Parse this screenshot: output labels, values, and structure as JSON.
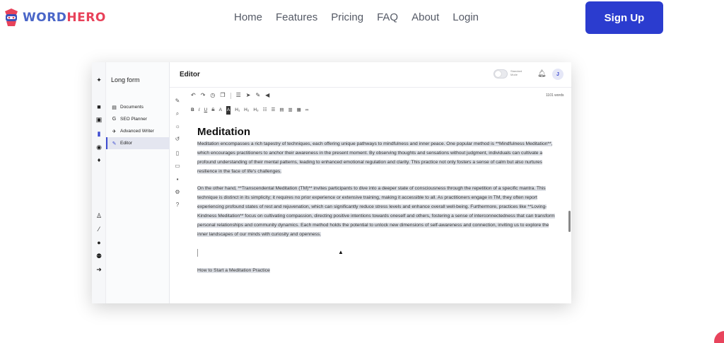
{
  "brand": {
    "name_part1": "WORD",
    "name_part2": "HERO"
  },
  "nav": [
    "Home",
    "Features",
    "Pricing",
    "FAQ",
    "About",
    "Login"
  ],
  "signup_label": "Sign Up",
  "app": {
    "sidebar_title": "Long form",
    "sidebar_items": [
      {
        "icon": "document-icon",
        "glyph": "▤",
        "label": "Documents"
      },
      {
        "icon": "google-icon",
        "glyph": "G",
        "label": "SEO Planner"
      },
      {
        "icon": "rocket-icon",
        "glyph": "✈",
        "label": "Advanced Writer"
      },
      {
        "icon": "pen-icon",
        "glyph": "✎",
        "label": "Editor"
      }
    ],
    "header_title": "Editor",
    "toggle_label": "Standard Mode",
    "avatar_initial": "J",
    "word_count": "1101 words",
    "format_buttons": [
      "B",
      "I",
      "U",
      "S",
      "A",
      "A",
      "H₁",
      "H₂",
      "H₃"
    ],
    "doc": {
      "title": "Meditation",
      "paragraphs": [
        "Meditation encompasses a rich tapestry of techniques, each offering unique pathways to mindfulness and inner peace. One popular method is **Mindfulness Meditation**, which encourages practitioners to anchor their awareness in the present moment. By observing thoughts and sensations without judgment, individuals can cultivate a profound understanding of their mental patterns, leading to enhanced emotional regulation and clarity. This practice not only fosters a sense of calm but also nurtures resilience in the face of life's challenges.",
        "On the other hand, **Transcendental Meditation (TM)** invites participants to dive into a deeper state of consciousness through the repetition of a specific mantra. This technique is distinct in its simplicity; it requires no prior experience or extensive training, making it accessible to all. As practitioners engage in TM, they often report experiencing profound states of rest and rejuvenation, which can significantly reduce stress levels and enhance overall well-being. Furthermore, practices like **Loving-Kindness Meditation** focus on cultivating compassion, directing positive intentions towards oneself and others, fostering a sense of interconnectedness that can transform personal relationships and community dynamics. Each method holds the potential to unlock new dimensions of self-awareness and connection, inviting us to explore the inner landscapes of our minds with curiosity and openness."
      ],
      "subheading": "How to Start a Meditation Practice"
    }
  },
  "colors": {
    "primary": "#2b3ccf",
    "brand_blue": "#4a66c8",
    "brand_red": "#e8425a",
    "highlight": "#dde0e6"
  }
}
